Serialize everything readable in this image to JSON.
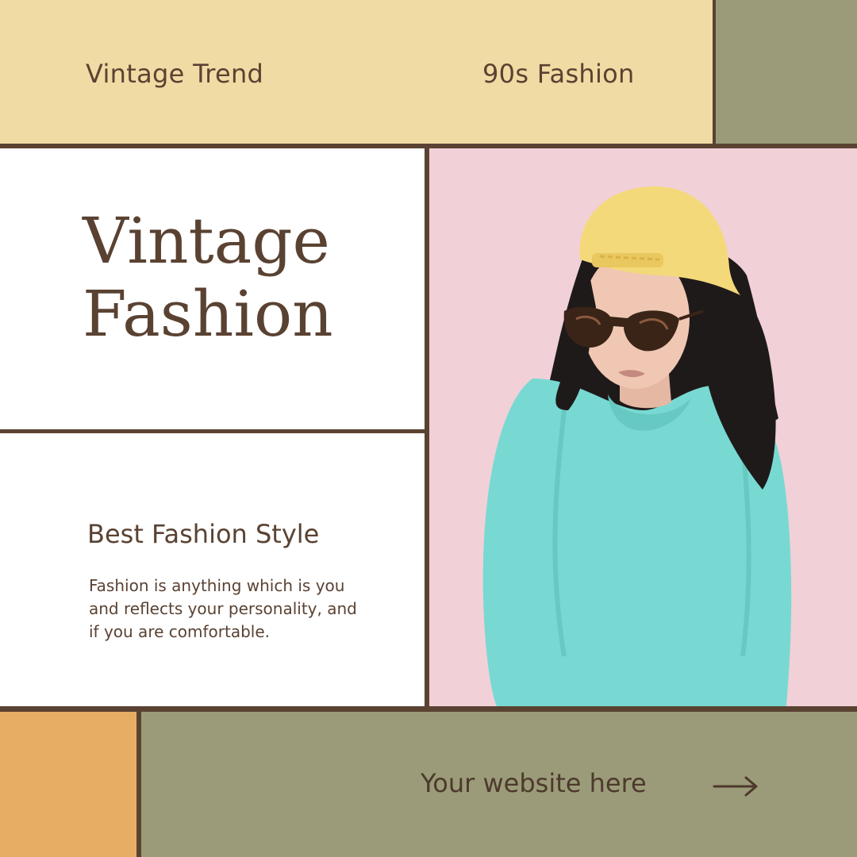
{
  "header": {
    "left_tag": "Vintage Trend",
    "right_tag": "90s Fashion"
  },
  "hero": {
    "title_line1": "Vintage",
    "title_line2": "Fashion"
  },
  "content": {
    "subheading": "Best Fashion Style",
    "body": "Fashion is anything which is you and reflects your personality, and if you are comfortable."
  },
  "footer": {
    "website": "Your website here",
    "arrow_icon": "arrow-right-icon"
  },
  "colors": {
    "cream": "#f0dba4",
    "olive": "#9b9b79",
    "orange": "#e8ad64",
    "pink": "#f1d0d8",
    "brown": "#5a4232",
    "teal": "#78d9d2",
    "cap_yellow": "#f4d97a"
  }
}
